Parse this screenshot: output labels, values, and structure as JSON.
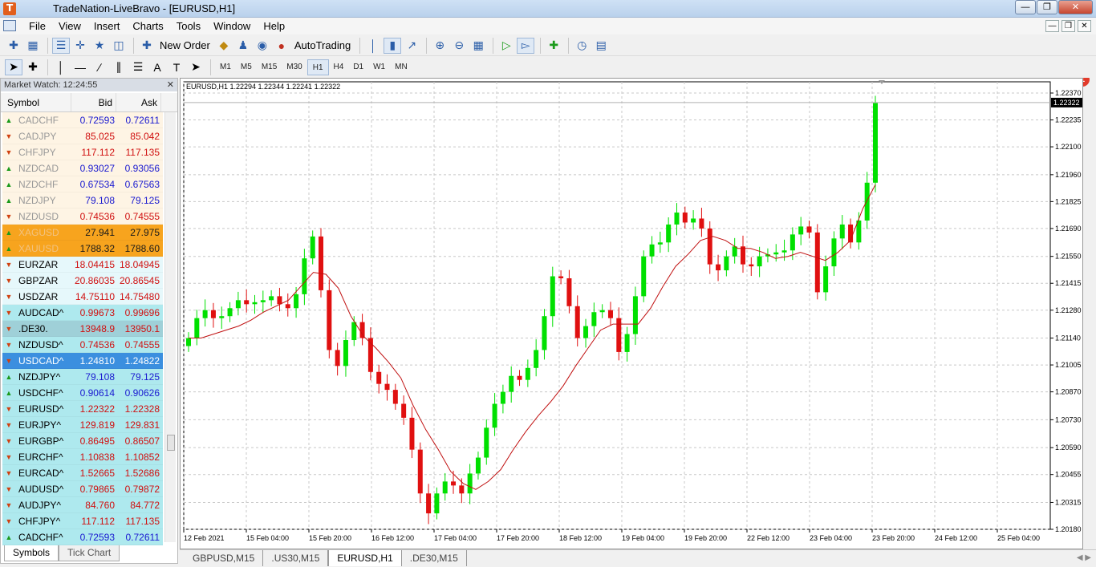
{
  "window": {
    "title": "TradeNation-LiveBravo - [EURUSD,H1]"
  },
  "menu": [
    "File",
    "View",
    "Insert",
    "Charts",
    "Tools",
    "Window",
    "Help"
  ],
  "toolbar": {
    "new_order": "New Order",
    "autotrading": "AutoTrading",
    "notifications": "1"
  },
  "timeframes": [
    "M1",
    "M5",
    "M15",
    "M30",
    "H1",
    "H4",
    "D1",
    "W1",
    "MN"
  ],
  "active_timeframe": "H1",
  "market_watch": {
    "title": "Market Watch: 12:24:55",
    "col_symbol": "Symbol",
    "col_bid": "Bid",
    "col_ask": "Ask",
    "rows": [
      {
        "dir": "up",
        "symbol": "CADCHF",
        "bid": "0.72593",
        "ask": "0.72611",
        "bg": "#fef4e4",
        "color": "#1a1ad0",
        "sym_color": "#999999"
      },
      {
        "dir": "dn",
        "symbol": "CADJPY",
        "bid": "85.025",
        "ask": "85.042",
        "bg": "#fef4e4",
        "color": "#d01010",
        "sym_color": "#999999"
      },
      {
        "dir": "dn",
        "symbol": "CHFJPY",
        "bid": "117.112",
        "ask": "117.135",
        "bg": "#fef4e4",
        "color": "#d01010",
        "sym_color": "#999999"
      },
      {
        "dir": "up",
        "symbol": "NZDCAD",
        "bid": "0.93027",
        "ask": "0.93056",
        "bg": "#fef4e4",
        "color": "#1a1ad0",
        "sym_color": "#999999"
      },
      {
        "dir": "up",
        "symbol": "NZDCHF",
        "bid": "0.67534",
        "ask": "0.67563",
        "bg": "#fef4e4",
        "color": "#1a1ad0",
        "sym_color": "#999999"
      },
      {
        "dir": "up",
        "symbol": "NZDJPY",
        "bid": "79.108",
        "ask": "79.125",
        "bg": "#fef4e4",
        "color": "#1a1ad0",
        "sym_color": "#999999"
      },
      {
        "dir": "dn",
        "symbol": "NZDUSD",
        "bid": "0.74536",
        "ask": "0.74555",
        "bg": "#fef4e4",
        "color": "#d01010",
        "sym_color": "#999999"
      },
      {
        "dir": "up",
        "symbol": "XAGUSD",
        "bid": "27.941",
        "ask": "27.975",
        "bg": "#f7a41e",
        "color": "#1a1a1a",
        "sym_color": "#f2c280"
      },
      {
        "dir": "up",
        "symbol": "XAUUSD",
        "bid": "1788.32",
        "ask": "1788.60",
        "bg": "#f7a41e",
        "color": "#1a1a1a",
        "sym_color": "#f2c280"
      },
      {
        "dir": "dn",
        "symbol": "EURZAR",
        "bid": "18.04415",
        "ask": "18.04945",
        "bg": "#e6f8fb",
        "color": "#d01010",
        "sym_color": "#000000"
      },
      {
        "dir": "dn",
        "symbol": "GBPZAR",
        "bid": "20.86035",
        "ask": "20.86545",
        "bg": "#e6f8fb",
        "color": "#d01010",
        "sym_color": "#000000"
      },
      {
        "dir": "dn",
        "symbol": "USDZAR",
        "bid": "14.75110",
        "ask": "14.75480",
        "bg": "#e6f8fb",
        "color": "#d01010",
        "sym_color": "#000000"
      },
      {
        "dir": "dn",
        "symbol": "AUDCAD^",
        "bid": "0.99673",
        "ask": "0.99696",
        "bg": "#aee9ee",
        "color": "#d01010",
        "sym_color": "#000000"
      },
      {
        "dir": "dn",
        "symbol": ".DE30.",
        "bid": "13948.9",
        "ask": "13950.1",
        "bg": "#9fd0d8",
        "color": "#d01010",
        "sym_color": "#000000"
      },
      {
        "dir": "dn",
        "symbol": "NZDUSD^",
        "bid": "0.74536",
        "ask": "0.74555",
        "bg": "#aee9ee",
        "color": "#d01010",
        "sym_color": "#000000"
      },
      {
        "dir": "dn",
        "symbol": "USDCAD^",
        "bid": "1.24810",
        "ask": "1.24822",
        "bg": "#3b8fdf",
        "color": "#ffffff",
        "sym_color": "#ffffff"
      },
      {
        "dir": "up",
        "symbol": "NZDJPY^",
        "bid": "79.108",
        "ask": "79.125",
        "bg": "#aee9ee",
        "color": "#1a1ad0",
        "sym_color": "#000000"
      },
      {
        "dir": "up",
        "symbol": "USDCHF^",
        "bid": "0.90614",
        "ask": "0.90626",
        "bg": "#aee9ee",
        "color": "#1a1ad0",
        "sym_color": "#000000"
      },
      {
        "dir": "dn",
        "symbol": "EURUSD^",
        "bid": "1.22322",
        "ask": "1.22328",
        "bg": "#aee9ee",
        "color": "#d01010",
        "sym_color": "#000000"
      },
      {
        "dir": "dn",
        "symbol": "EURJPY^",
        "bid": "129.819",
        "ask": "129.831",
        "bg": "#aee9ee",
        "color": "#d01010",
        "sym_color": "#000000"
      },
      {
        "dir": "dn",
        "symbol": "EURGBP^",
        "bid": "0.86495",
        "ask": "0.86507",
        "bg": "#aee9ee",
        "color": "#d01010",
        "sym_color": "#000000"
      },
      {
        "dir": "dn",
        "symbol": "EURCHF^",
        "bid": "1.10838",
        "ask": "1.10852",
        "bg": "#aee9ee",
        "color": "#d01010",
        "sym_color": "#000000"
      },
      {
        "dir": "dn",
        "symbol": "EURCAD^",
        "bid": "1.52665",
        "ask": "1.52686",
        "bg": "#aee9ee",
        "color": "#d01010",
        "sym_color": "#000000"
      },
      {
        "dir": "dn",
        "symbol": "AUDUSD^",
        "bid": "0.79865",
        "ask": "0.79872",
        "bg": "#aee9ee",
        "color": "#d01010",
        "sym_color": "#000000"
      },
      {
        "dir": "dn",
        "symbol": "AUDJPY^",
        "bid": "84.760",
        "ask": "84.772",
        "bg": "#aee9ee",
        "color": "#d01010",
        "sym_color": "#000000"
      },
      {
        "dir": "dn",
        "symbol": "CHFJPY^",
        "bid": "117.112",
        "ask": "117.135",
        "bg": "#aee9ee",
        "color": "#d01010",
        "sym_color": "#000000"
      },
      {
        "dir": "up",
        "symbol": "CADCHF^",
        "bid": "0.72593",
        "ask": "0.72611",
        "bg": "#aee9ee",
        "color": "#1a1ad0",
        "sym_color": "#000000"
      }
    ],
    "tabs": [
      "Symbols",
      "Tick Chart"
    ]
  },
  "chart_header": "EURUSD,H1  1.22294 1.22344 1.22241 1.22322",
  "chart_tabs": [
    "GBPUSD,M15",
    ".US30,M15",
    "EURUSD,H1",
    ".DE30,M15"
  ],
  "active_chart_tab": "EURUSD,H1",
  "chart_data": {
    "type": "line",
    "symbol": "EURUSD",
    "timeframe": "H1",
    "current_price": "1.22322",
    "ylim": [
      1.2018,
      1.2237
    ],
    "y_ticks": [
      "1.22370",
      "1.22235",
      "1.22100",
      "1.21960",
      "1.21825",
      "1.21690",
      "1.21550",
      "1.21415",
      "1.21280",
      "1.21140",
      "1.21005",
      "1.20870",
      "1.20730",
      "1.20590",
      "1.20455",
      "1.20315",
      "1.20180"
    ],
    "x_ticks": [
      "12 Feb 2021",
      "15 Feb 04:00",
      "15 Feb 20:00",
      "16 Feb 12:00",
      "17 Feb 04:00",
      "17 Feb 20:00",
      "18 Feb 12:00",
      "19 Feb 04:00",
      "19 Feb 20:00",
      "22 Feb 12:00",
      "23 Feb 04:00",
      "23 Feb 20:00",
      "24 Feb 12:00",
      "25 Feb 04:00"
    ],
    "series": [
      {
        "style": "candles",
        "up_color": "#00e000",
        "down_color": "#e01010",
        "close": [
          1.2114,
          1.2124,
          1.2128,
          1.2124,
          1.2125,
          1.2129,
          1.2133,
          1.2131,
          1.2132,
          1.2133,
          1.2135,
          1.2131,
          1.2129,
          1.2136,
          1.2154,
          1.2165,
          1.2138,
          1.2108,
          1.21,
          1.2113,
          1.2122,
          1.2114,
          1.2097,
          1.2091,
          1.2088,
          1.2081,
          1.2074,
          1.2058,
          1.2036,
          1.2026,
          1.2036,
          1.2042,
          1.204,
          1.2036,
          1.2046,
          1.2054,
          1.2069,
          1.2081,
          1.2087,
          1.2095,
          1.2093,
          1.2099,
          1.2108,
          1.2125,
          1.2145,
          1.2144,
          1.213,
          1.2114,
          1.212,
          1.2127,
          1.2128,
          1.2124,
          1.2107,
          1.2116,
          1.2135,
          1.2155,
          1.2161,
          1.2162,
          1.2171,
          1.2177,
          1.2172,
          1.2174,
          1.2169,
          1.2151,
          1.2148,
          1.2155,
          1.216,
          1.2151,
          1.215,
          1.2155,
          1.2156,
          1.2157,
          1.2158,
          1.2166,
          1.217,
          1.2167,
          1.2137,
          1.215,
          1.2164,
          1.2171,
          1.2162,
          1.2173,
          1.2192,
          1.2232
        ],
        "ma_close": [
          1.2114,
          1.2114,
          1.2116,
          1.2118,
          1.212,
          1.2123,
          1.2127,
          1.213,
          1.2133,
          1.214,
          1.2147,
          1.2146,
          1.2139,
          1.2125,
          1.2115,
          1.2109,
          1.2102,
          1.2094,
          1.208,
          1.2068,
          1.2058,
          1.2047,
          1.2041,
          1.2038,
          1.2042,
          1.2048,
          1.2058,
          1.2067,
          1.2075,
          1.2082,
          1.209,
          1.21,
          1.2109,
          1.2118,
          1.2121,
          1.2121,
          1.2121,
          1.2129,
          1.214,
          1.215,
          1.2156,
          1.2163,
          1.2165,
          1.2163,
          1.2159,
          1.2159,
          1.2157,
          1.2154,
          1.2155,
          1.2157,
          1.2155,
          1.2153,
          1.2157,
          1.2163,
          1.2179,
          1.2191
        ]
      }
    ]
  }
}
